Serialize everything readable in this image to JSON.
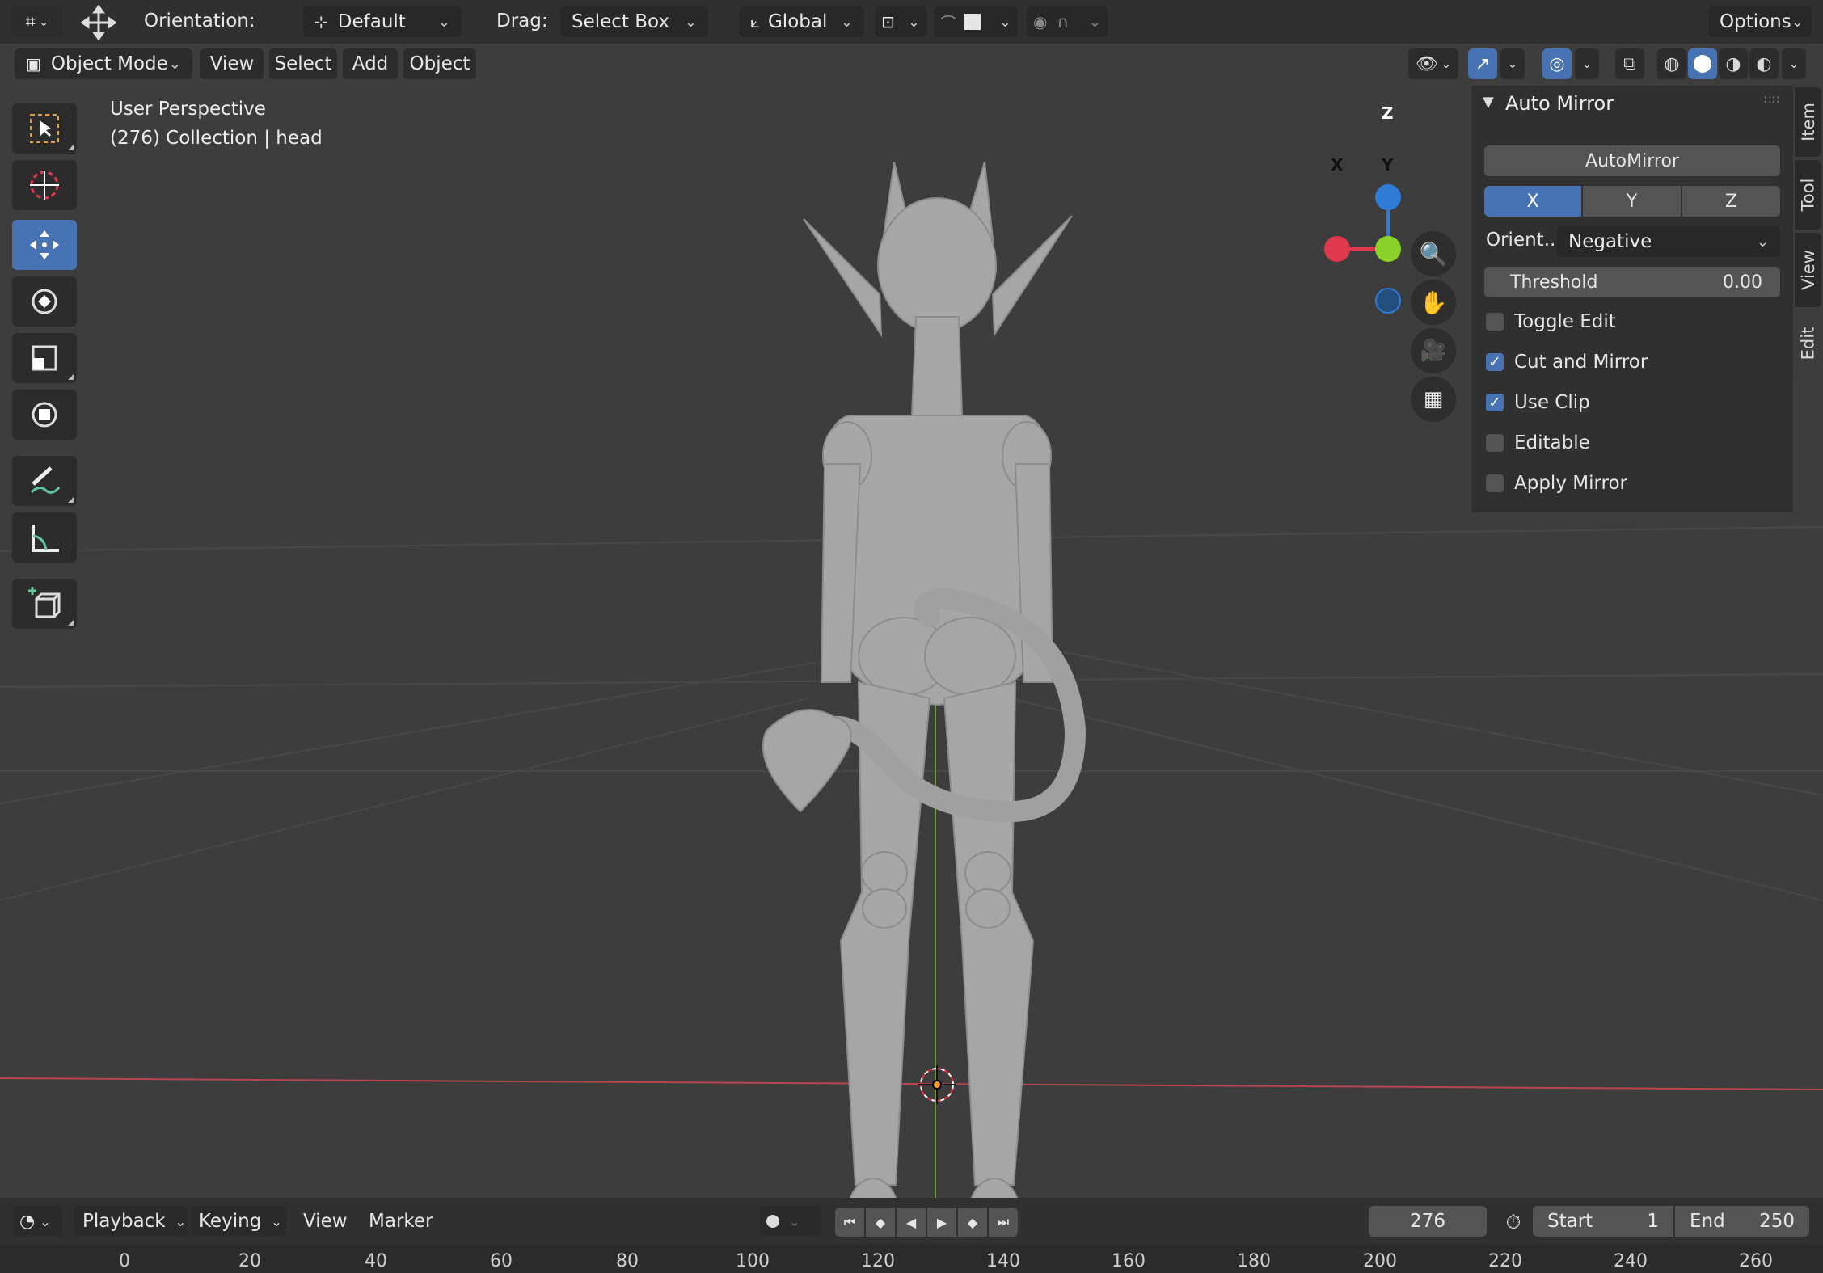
{
  "header": {
    "orientation_label": "Orientation:",
    "orientation_value": "Default",
    "drag_label": "Drag:",
    "drag_value": "Select Box",
    "transform_orientation": "Global",
    "options_label": "Options"
  },
  "mode_bar": {
    "mode": "Object Mode",
    "menus": [
      "View",
      "Select",
      "Add",
      "Object"
    ]
  },
  "viewport": {
    "perspective_label": "User Perspective",
    "collection_label": "(276) Collection | head",
    "gizmo": {
      "z_label": "Z",
      "y_label": "Y",
      "x_label": "X"
    }
  },
  "toolbar": {
    "tools": [
      "select-box",
      "cursor",
      "move",
      "rotate",
      "scale",
      "transform",
      "annotate",
      "measure",
      "add-cube"
    ],
    "active_tool": "move"
  },
  "sidebar": {
    "panel_title": "Auto Mirror",
    "automirror_button": "AutoMirror",
    "axes": [
      "X",
      "Y",
      "Z"
    ],
    "selected_axis": "X",
    "orient_label": "Orient...",
    "orient_value": "Negative",
    "threshold_label": "Threshold",
    "threshold_value": "0.00",
    "checkboxes": [
      {
        "label": "Toggle Edit",
        "checked": false
      },
      {
        "label": "Cut and Mirror",
        "checked": true
      },
      {
        "label": "Use Clip",
        "checked": true
      },
      {
        "label": "Editable",
        "checked": false
      },
      {
        "label": "Apply Mirror",
        "checked": false
      }
    ],
    "tabs": [
      "Item",
      "Tool",
      "View",
      "Edit"
    ],
    "active_tab": "Edit"
  },
  "timeline": {
    "menus": {
      "playback": "Playback",
      "keying": "Keying",
      "view": "View",
      "marker": "Marker"
    },
    "current_frame": "276",
    "start_label": "Start",
    "start_value": "1",
    "end_label": "End",
    "end_value": "250",
    "ruler": [
      "0",
      "20",
      "40",
      "60",
      "80",
      "100",
      "120",
      "140",
      "160",
      "180",
      "200",
      "220",
      "240",
      "260"
    ]
  },
  "colors": {
    "accent": "#4772b3",
    "axis_x": "#e0394e",
    "axis_y": "#8ad12a",
    "axis_z": "#2f7bd6",
    "model": "#a6a6a6"
  }
}
